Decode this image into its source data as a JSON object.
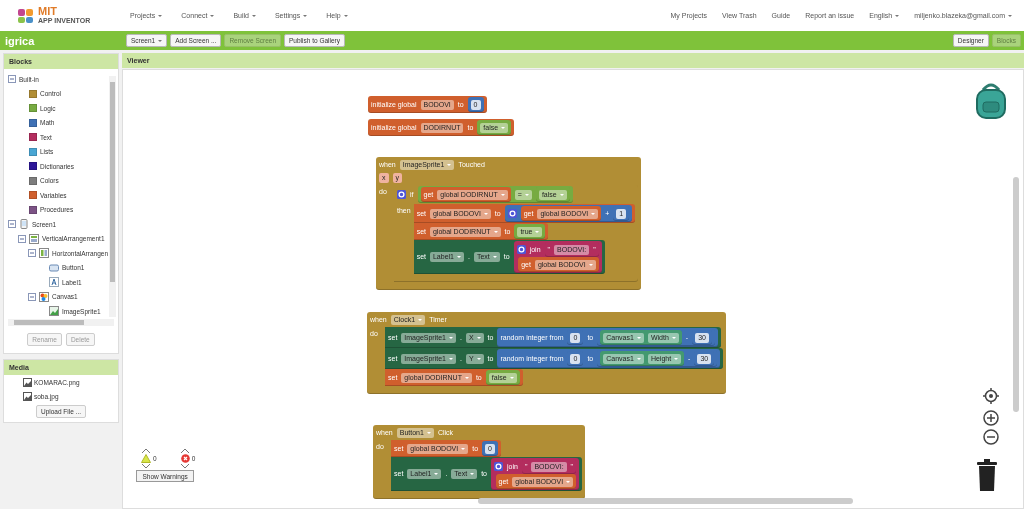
{
  "topbar": {
    "logo": {
      "title": "MIT",
      "subtitle": "APP INVENTOR"
    },
    "menus": [
      {
        "label": "Projects",
        "dropdown": true
      },
      {
        "label": "Connect",
        "dropdown": true
      },
      {
        "label": "Build",
        "dropdown": true
      },
      {
        "label": "Settings",
        "dropdown": true
      },
      {
        "label": "Help",
        "dropdown": true
      }
    ],
    "links": [
      {
        "label": "My Projects",
        "dropdown": false
      },
      {
        "label": "View Trash",
        "dropdown": false
      },
      {
        "label": "Guide",
        "dropdown": false
      },
      {
        "label": "Report an issue",
        "dropdown": false
      },
      {
        "label": "English",
        "dropdown": true
      },
      {
        "label": "miljenko.blazeka@gmail.com",
        "dropdown": true
      }
    ]
  },
  "project_bar": {
    "title": "igrica",
    "buttons": [
      {
        "label": "Screen1",
        "dropdown": true,
        "disabled": false
      },
      {
        "label": "Add Screen ...",
        "dropdown": false,
        "disabled": false
      },
      {
        "label": "Remove Screen",
        "dropdown": false,
        "disabled": true
      },
      {
        "label": "Publish to Gallery",
        "dropdown": false,
        "disabled": false
      }
    ],
    "view_buttons": [
      {
        "label": "Designer",
        "selected": false
      },
      {
        "label": "Blocks",
        "selected": true
      }
    ]
  },
  "blocks_panel": {
    "title": "Blocks",
    "tree": [
      {
        "label": "Built-in",
        "expanded": true,
        "children": [
          {
            "label": "Control",
            "color": "#b18e35"
          },
          {
            "label": "Logic",
            "color": "#77ab41"
          },
          {
            "label": "Math",
            "color": "#3f71b5"
          },
          {
            "label": "Text",
            "color": "#b32d5e"
          },
          {
            "label": "Lists",
            "color": "#49a6d4"
          },
          {
            "label": "Dictionaries",
            "color": "#2d1799"
          },
          {
            "label": "Colors",
            "color": "#7d7d7d"
          },
          {
            "label": "Variables",
            "color": "#d05f2d"
          },
          {
            "label": "Procedures",
            "color": "#7c5385"
          }
        ]
      },
      {
        "label": "Screen1",
        "kind": "screen",
        "expanded": true,
        "children": [
          {
            "label": "VerticalArrangement1",
            "kind": "vertical",
            "expanded": true,
            "children": [
              {
                "label": "HorizontalArrangen",
                "kind": "horizontal",
                "expanded": true,
                "children": [
                  {
                    "label": "Button1",
                    "kind": "button"
                  },
                  {
                    "label": "Label1",
                    "kind": "label"
                  }
                ]
              },
              {
                "label": "Canvas1",
                "kind": "canvas",
                "expanded": true,
                "children": [
                  {
                    "label": "ImageSprite1",
                    "kind": "sprite"
                  }
                ]
              }
            ]
          }
        ]
      }
    ],
    "buttons": [
      {
        "label": "Rename",
        "disabled": true
      },
      {
        "label": "Delete",
        "disabled": true
      }
    ]
  },
  "media_panel": {
    "title": "Media",
    "files": [
      "KOMARAC.png",
      "soba.jpg"
    ],
    "upload_button": "Upload File ..."
  },
  "viewer": {
    "title": "Viewer",
    "blocks": [
      {
        "kind": "variables",
        "rows": [
          {
            "parts": [
              {
                "kind": "label",
                "text": "initialize global"
              },
              {
                "kind": "field",
                "text": "BODOVI"
              },
              {
                "kind": "label",
                "text": "to"
              },
              {
                "kind": "input",
                "block": {
                  "kind": "math",
                  "rows": [
                    {
                      "parts": [
                        {
                          "kind": "number",
                          "text": "0"
                        }
                      ]
                    }
                  ]
                }
              }
            ]
          }
        ]
      },
      {
        "kind": "variables",
        "rows": [
          {
            "parts": [
              {
                "kind": "label",
                "text": "initialize global"
              },
              {
                "kind": "field",
                "text": "DODIRNUT"
              },
              {
                "kind": "label",
                "text": "to"
              },
              {
                "kind": "input",
                "block": {
                  "kind": "logic",
                  "rows": [
                    {
                      "parts": [
                        {
                          "kind": "dropdown",
                          "text": "false"
                        }
                      ]
                    }
                  ]
                }
              }
            ]
          }
        ]
      },
      {
        "kind": "event",
        "rows": [
          {
            "parts": [
              {
                "kind": "label",
                "text": "when"
              },
              {
                "kind": "dropdown",
                "text": "ImageSprite1"
              },
              {
                "kind": "label",
                "text": "Touched"
              }
            ]
          },
          {
            "parts": [
              {
                "kind": "param",
                "text": "x"
              },
              {
                "kind": "param",
                "text": "y"
              }
            ]
          },
          {
            "label": "do",
            "body": [
              {
                "kind": "control",
                "rows": [
                  {
                    "parts": [
                      {
                        "kind": "gear"
                      },
                      {
                        "kind": "label",
                        "text": "if"
                      },
                      {
                        "kind": "input",
                        "block": {
                          "kind": "logic",
                          "rows": [
                            {
                              "parts": [
                                {
                                  "kind": "input",
                                  "block": {
                                    "kind": "variables",
                                    "rows": [
                                      {
                                        "parts": [
                                          {
                                            "kind": "label",
                                            "text": "get"
                                          },
                                          {
                                            "kind": "dropdown",
                                            "text": "global DODIRNUT"
                                          }
                                        ]
                                      }
                                    ]
                                  }
                                },
                                {
                                  "kind": "dropdown",
                                  "text": "="
                                },
                                {
                                  "kind": "input",
                                  "block": {
                                    "kind": "logic",
                                    "rows": [
                                      {
                                        "parts": [
                                          {
                                            "kind": "dropdown",
                                            "text": "false"
                                          }
                                        ]
                                      }
                                    ]
                                  }
                                }
                              ]
                            }
                          ]
                        }
                      }
                    ]
                  },
                  {
                    "label": "then",
                    "body": [
                      {
                        "kind": "variables",
                        "rows": [
                          {
                            "parts": [
                              {
                                "kind": "label",
                                "text": "set"
                              },
                              {
                                "kind": "dropdown",
                                "text": "global BODOVI"
                              },
                              {
                                "kind": "label",
                                "text": "to"
                              },
                              {
                                "kind": "input",
                                "block": {
                                  "kind": "math",
                                  "rows": [
                                    {
                                      "parts": [
                                        {
                                          "kind": "gear"
                                        },
                                        {
                                          "kind": "input",
                                          "block": {
                                            "kind": "variables",
                                            "rows": [
                                              {
                                                "parts": [
                                                  {
                                                    "kind": "label",
                                                    "text": "get"
                                                  },
                                                  {
                                                    "kind": "dropdown",
                                                    "text": "global BODOVI"
                                                  }
                                                ]
                                              }
                                            ]
                                          }
                                        },
                                        {
                                          "kind": "label",
                                          "text": "+"
                                        },
                                        {
                                          "kind": "input",
                                          "block": {
                                            "kind": "math",
                                            "rows": [
                                              {
                                                "parts": [
                                                  {
                                                    "kind": "number",
                                                    "text": "1"
                                                  }
                                                ]
                                              }
                                            ]
                                          }
                                        }
                                      ]
                                    }
                                  ]
                                }
                              }
                            ]
                          }
                        ]
                      },
                      {
                        "kind": "variables",
                        "rows": [
                          {
                            "parts": [
                              {
                                "kind": "label",
                                "text": "set"
                              },
                              {
                                "kind": "dropdown",
                                "text": "global DODIRNUT"
                              },
                              {
                                "kind": "label",
                                "text": "to"
                              },
                              {
                                "kind": "input",
                                "block": {
                                  "kind": "logic",
                                  "rows": [
                                    {
                                      "parts": [
                                        {
                                          "kind": "dropdown",
                                          "text": "true"
                                        }
                                      ]
                                    }
                                  ]
                                }
                              }
                            ]
                          }
                        ]
                      },
                      {
                        "kind": "setter",
                        "rows": [
                          {
                            "parts": [
                              {
                                "kind": "label",
                                "text": "set"
                              },
                              {
                                "kind": "dropdown",
                                "text": "Label1"
                              },
                              {
                                "kind": "label",
                                "text": "."
                              },
                              {
                                "kind": "dropdown",
                                "text": "Text"
                              },
                              {
                                "kind": "label",
                                "text": "to"
                              },
                              {
                                "kind": "input",
                                "block": {
                                  "kind": "text",
                                  "rows": [
                                    {
                                      "parts": [
                                        {
                                          "kind": "gear"
                                        },
                                        {
                                          "kind": "label",
                                          "text": "join"
                                        },
                                        {
                                          "kind": "input",
                                          "block": {
                                            "kind": "text",
                                            "rows": [
                                              {
                                                "parts": [
                                                  {
                                                    "kind": "label",
                                                    "text": "\""
                                                  },
                                                  {
                                                    "kind": "field",
                                                    "text": "BODOVI:"
                                                  },
                                                  {
                                                    "kind": "label",
                                                    "text": "\""
                                                  }
                                                ]
                                              }
                                            ]
                                          }
                                        }
                                      ]
                                    },
                                    {
                                      "parts": [
                                        {
                                          "kind": "input",
                                          "block": {
                                            "kind": "variables",
                                            "rows": [
                                              {
                                                "parts": [
                                                  {
                                                    "kind": "label",
                                                    "text": "get"
                                                  },
                                                  {
                                                    "kind": "dropdown",
                                                    "text": "global BODOVI"
                                                  }
                                                ]
                                              }
                                            ]
                                          }
                                        }
                                      ]
                                    }
                                  ]
                                }
                              }
                            ]
                          }
                        ]
                      }
                    ]
                  }
                ]
              }
            ]
          }
        ]
      },
      {
        "kind": "event",
        "rows": [
          {
            "parts": [
              {
                "kind": "label",
                "text": "when"
              },
              {
                "kind": "dropdown",
                "text": "Clock1"
              },
              {
                "kind": "label",
                "text": "Timer"
              }
            ]
          },
          {
            "label": "do",
            "body": [
              {
                "kind": "setter",
                "rows": [
                  {
                    "parts": [
                      {
                        "kind": "label",
                        "text": "set"
                      },
                      {
                        "kind": "dropdown",
                        "text": "ImageSprite1"
                      },
                      {
                        "kind": "label",
                        "text": "."
                      },
                      {
                        "kind": "dropdown",
                        "text": "X"
                      },
                      {
                        "kind": "label",
                        "text": "to"
                      },
                      {
                        "kind": "input",
                        "block": {
                          "kind": "math",
                          "rows": [
                            {
                              "parts": [
                                {
                                  "kind": "label",
                                  "text": "random integer from"
                                },
                                {
                                  "kind": "input",
                                  "block": {
                                    "kind": "math",
                                    "rows": [
                                      {
                                        "parts": [
                                          {
                                            "kind": "number",
                                            "text": "0"
                                          }
                                        ]
                                      }
                                    ]
                                  }
                                },
                                {
                                  "kind": "label",
                                  "text": "to"
                                },
                                {
                                  "kind": "input",
                                  "block": {
                                    "kind": "math",
                                    "rows": [
                                      {
                                        "parts": [
                                          {
                                            "kind": "input",
                                            "block": {
                                              "kind": "getter",
                                              "rows": [
                                                {
                                                  "parts": [
                                                    {
                                                      "kind": "dropdown",
                                                      "text": "Canvas1"
                                                    },
                                                    {
                                                      "kind": "dropdown",
                                                      "text": "Width"
                                                    }
                                                  ]
                                                }
                                              ]
                                            }
                                          },
                                          {
                                            "kind": "label",
                                            "text": "-"
                                          },
                                          {
                                            "kind": "input",
                                            "block": {
                                              "kind": "math",
                                              "rows": [
                                                {
                                                  "parts": [
                                                    {
                                                      "kind": "number",
                                                      "text": "30"
                                                    }
                                                  ]
                                                }
                                              ]
                                            }
                                          }
                                        ]
                                      }
                                    ]
                                  }
                                }
                              ]
                            }
                          ]
                        }
                      }
                    ]
                  }
                ]
              },
              {
                "kind": "setter",
                "rows": [
                  {
                    "parts": [
                      {
                        "kind": "label",
                        "text": "set"
                      },
                      {
                        "kind": "dropdown",
                        "text": "ImageSprite1"
                      },
                      {
                        "kind": "label",
                        "text": "."
                      },
                      {
                        "kind": "dropdown",
                        "text": "Y"
                      },
                      {
                        "kind": "label",
                        "text": "to"
                      },
                      {
                        "kind": "input",
                        "block": {
                          "kind": "math",
                          "rows": [
                            {
                              "parts": [
                                {
                                  "kind": "label",
                                  "text": "random integer from"
                                },
                                {
                                  "kind": "input",
                                  "block": {
                                    "kind": "math",
                                    "rows": [
                                      {
                                        "parts": [
                                          {
                                            "kind": "number",
                                            "text": "0"
                                          }
                                        ]
                                      }
                                    ]
                                  }
                                },
                                {
                                  "kind": "label",
                                  "text": "to"
                                },
                                {
                                  "kind": "input",
                                  "block": {
                                    "kind": "math",
                                    "rows": [
                                      {
                                        "parts": [
                                          {
                                            "kind": "input",
                                            "block": {
                                              "kind": "getter",
                                              "rows": [
                                                {
                                                  "parts": [
                                                    {
                                                      "kind": "dropdown",
                                                      "text": "Canvas1"
                                                    },
                                                    {
                                                      "kind": "dropdown",
                                                      "text": "Height"
                                                    }
                                                  ]
                                                }
                                              ]
                                            }
                                          },
                                          {
                                            "kind": "label",
                                            "text": "-"
                                          },
                                          {
                                            "kind": "input",
                                            "block": {
                                              "kind": "math",
                                              "rows": [
                                                {
                                                  "parts": [
                                                    {
                                                      "kind": "number",
                                                      "text": "30"
                                                    }
                                                  ]
                                                }
                                              ]
                                            }
                                          }
                                        ]
                                      }
                                    ]
                                  }
                                }
                              ]
                            }
                          ]
                        }
                      }
                    ]
                  }
                ]
              },
              {
                "kind": "variables",
                "rows": [
                  {
                    "parts": [
                      {
                        "kind": "label",
                        "text": "set"
                      },
                      {
                        "kind": "dropdown",
                        "text": "global DODIRNUT"
                      },
                      {
                        "kind": "label",
                        "text": "to"
                      },
                      {
                        "kind": "input",
                        "block": {
                          "kind": "logic",
                          "rows": [
                            {
                              "parts": [
                                {
                                  "kind": "dropdown",
                                  "text": "false"
                                }
                              ]
                            }
                          ]
                        }
                      }
                    ]
                  }
                ]
              }
            ]
          }
        ]
      },
      {
        "kind": "event",
        "rows": [
          {
            "parts": [
              {
                "kind": "label",
                "text": "when"
              },
              {
                "kind": "dropdown",
                "text": "Button1"
              },
              {
                "kind": "label",
                "text": "Click"
              }
            ]
          },
          {
            "label": "do",
            "body": [
              {
                "kind": "variables",
                "rows": [
                  {
                    "parts": [
                      {
                        "kind": "label",
                        "text": "set"
                      },
                      {
                        "kind": "dropdown",
                        "text": "global BODOVI"
                      },
                      {
                        "kind": "label",
                        "text": "to"
                      },
                      {
                        "kind": "input",
                        "block": {
                          "kind": "math",
                          "rows": [
                            {
                              "parts": [
                                {
                                  "kind": "number",
                                  "text": "0"
                                }
                              ]
                            }
                          ]
                        }
                      }
                    ]
                  }
                ]
              },
              {
                "kind": "setter",
                "rows": [
                  {
                    "parts": [
                      {
                        "kind": "label",
                        "text": "set"
                      },
                      {
                        "kind": "dropdown",
                        "text": "Label1"
                      },
                      {
                        "kind": "label",
                        "text": "."
                      },
                      {
                        "kind": "dropdown",
                        "text": "Text"
                      },
                      {
                        "kind": "label",
                        "text": "to"
                      },
                      {
                        "kind": "input",
                        "block": {
                          "kind": "text",
                          "rows": [
                            {
                              "parts": [
                                {
                                  "kind": "gear"
                                },
                                {
                                  "kind": "label",
                                  "text": "join"
                                },
                                {
                                  "kind": "input",
                                  "block": {
                                    "kind": "text",
                                    "rows": [
                                      {
                                        "parts": [
                                          {
                                            "kind": "label",
                                            "text": "\""
                                          },
                                          {
                                            "kind": "field",
                                            "text": "BODOVI:"
                                          },
                                          {
                                            "kind": "label",
                                            "text": "\""
                                          }
                                        ]
                                      }
                                    ]
                                  }
                                }
                              ]
                            },
                            {
                              "parts": [
                                {
                                  "kind": "input",
                                  "block": {
                                    "kind": "variables",
                                    "rows": [
                                      {
                                        "parts": [
                                          {
                                            "kind": "label",
                                            "text": "get"
                                          },
                                          {
                                            "kind": "dropdown",
                                            "text": "global BODOVI"
                                          }
                                        ]
                                      }
                                    ]
                                  }
                                }
                              ]
                            }
                          ]
                        }
                      }
                    ]
                  }
                ]
              }
            ]
          }
        ]
      }
    ],
    "warnings": {
      "warning_count": "0",
      "error_count": "0",
      "button": "Show Warnings"
    }
  }
}
